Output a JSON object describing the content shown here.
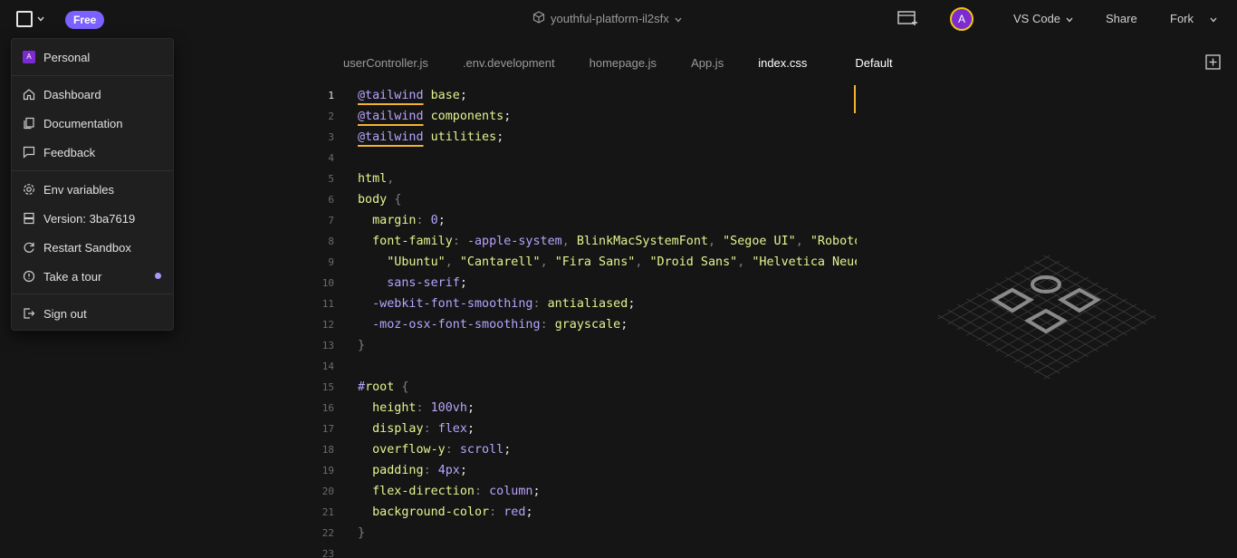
{
  "header": {
    "plan_badge": "Free",
    "project_name": "youthful-platform-il2sfx",
    "avatar_initial": "A",
    "editor_selector": "VS Code",
    "share_label": "Share",
    "fork_label": "Fork"
  },
  "tabs": [
    {
      "label": "userController.js",
      "active": false
    },
    {
      "label": ".env.development",
      "active": false
    },
    {
      "label": "homepage.js",
      "active": false
    },
    {
      "label": "App.js",
      "active": false
    },
    {
      "label": "index.css",
      "active": true
    }
  ],
  "preview_tab": "Default",
  "editor": {
    "current_line": 1,
    "line_numbers": [
      "1",
      "2",
      "3",
      "4",
      "5",
      "6",
      "7",
      "8",
      "9",
      "10",
      "11",
      "12",
      "13",
      "14",
      "15",
      "16",
      "17",
      "18",
      "19",
      "20",
      "21",
      "22",
      "23"
    ]
  },
  "menu": {
    "workspace": {
      "initial": "A",
      "label": "Personal"
    },
    "items": [
      {
        "label": "Dashboard",
        "icon": "home-icon"
      },
      {
        "label": "Documentation",
        "icon": "docs-icon"
      },
      {
        "label": "Feedback",
        "icon": "chat-icon"
      },
      {
        "label": "Env variables",
        "icon": "gear-icon"
      },
      {
        "label": "Version: 3ba7619",
        "icon": "server-icon"
      },
      {
        "label": "Restart Sandbox",
        "icon": "restart-icon"
      },
      {
        "label": "Take a tour",
        "icon": "info-icon"
      },
      {
        "label": "Sign out",
        "icon": "sign-out-icon"
      }
    ]
  },
  "colors": {
    "accent": "#7b61ff",
    "cursor": "#f2b233",
    "avatar": "#7b2bd1",
    "keyword_purple": "#b8a4ff",
    "selector_yellow": "#e2f58f"
  }
}
